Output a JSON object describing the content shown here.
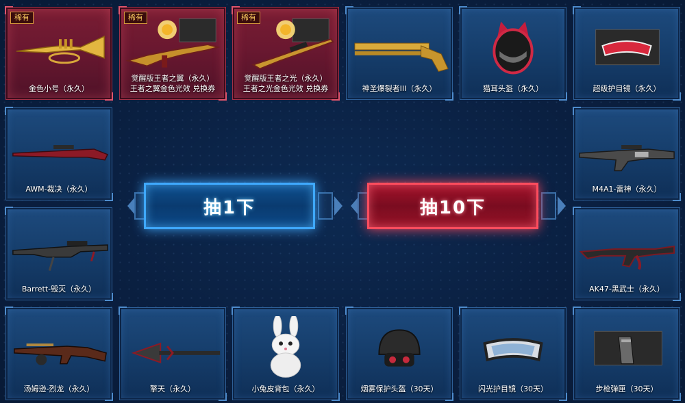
{
  "rare_badge": "稀有",
  "buttons": {
    "draw_one": "抽1下",
    "draw_ten": "抽10下"
  },
  "colors": {
    "rare_accent": "#a23148",
    "normal_accent": "#2e5f97",
    "draw_one_glow": "#3fa9ff",
    "draw_ten_glow": "#ff4d5e"
  },
  "prizes": [
    {
      "name": "金色小号（永久）",
      "rare": true,
      "icon": "gold-trumpet-icon"
    },
    {
      "name": "觉醒版王者之翼（永久）",
      "name2": "王者之翼金色光效 兑换券",
      "rare": true,
      "icon": "golden-wing-rifle-icon"
    },
    {
      "name": "觉醒版王者之光（永久）",
      "name2": "王者之光金色光效 兑换券",
      "rare": true,
      "icon": "golden-light-sniper-icon"
    },
    {
      "name": "神圣爆裂者III（永久）",
      "rare": false,
      "icon": "gold-shotgun-icon"
    },
    {
      "name": "猫耳头盔（永久）",
      "rare": false,
      "icon": "cat-ear-helmet-icon"
    },
    {
      "name": "超级护目镜（永久）",
      "rare": false,
      "icon": "red-goggles-icon"
    },
    {
      "name": "AWM-裁决（永久）",
      "rare": false,
      "icon": "awm-rifle-icon"
    },
    {
      "name": "M4A1-雷神（永久）",
      "rare": false,
      "icon": "m4a1-rifle-icon"
    },
    {
      "name": "Barrett-毁灭（永久）",
      "rare": false,
      "icon": "barrett-rifle-icon"
    },
    {
      "name": "AK47-黑武士（永久）",
      "rare": false,
      "icon": "ak47-rifle-icon"
    },
    {
      "name": "汤姆逊-烈龙（永久）",
      "rare": false,
      "icon": "thompson-smg-icon"
    },
    {
      "name": "擎天（永久）",
      "rare": false,
      "icon": "spear-icon"
    },
    {
      "name": "小兔皮背包（永久）",
      "rare": false,
      "icon": "bunny-backpack-icon"
    },
    {
      "name": "烟雾保护头盔（30天）",
      "rare": false,
      "icon": "gas-helmet-icon"
    },
    {
      "name": "闪光护目镜（30天）",
      "rare": false,
      "icon": "flash-goggles-icon"
    },
    {
      "name": "步枪弹匣（30天）",
      "rare": false,
      "icon": "rifle-magazine-icon"
    }
  ]
}
